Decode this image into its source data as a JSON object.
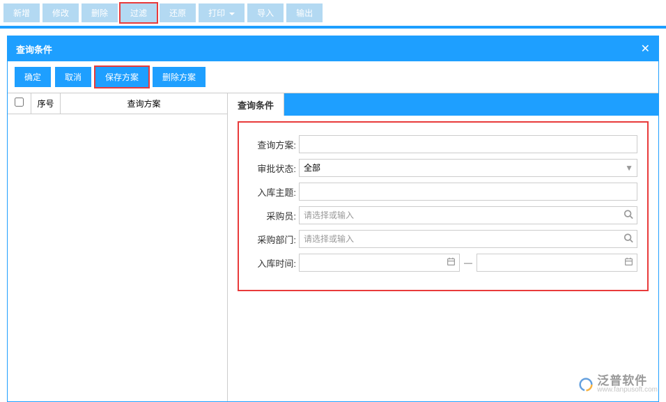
{
  "toolbar": {
    "new": "新增",
    "modify": "修改",
    "delete": "删除",
    "filter": "过滤",
    "restore": "还原",
    "print": "打印",
    "import": "导入",
    "export": "输出"
  },
  "panel": {
    "title": "查询条件"
  },
  "actions": {
    "confirm": "确定",
    "cancel": "取消",
    "save_scheme": "保存方案",
    "delete_scheme": "删除方案"
  },
  "table": {
    "seq": "序号",
    "scheme": "查询方案"
  },
  "tab": {
    "conditions": "查询条件"
  },
  "form": {
    "scheme_label": "查询方案:",
    "approval_label": "审批状态:",
    "approval_value": "全部",
    "subject_label": "入库主题:",
    "buyer_label": "采购员:",
    "buyer_placeholder": "请选择或输入",
    "dept_label": "采购部门:",
    "dept_placeholder": "请选择或输入",
    "time_label": "入库时间:",
    "range_sep": "—"
  },
  "watermark": {
    "cn": "泛普软件",
    "url": "www.fanpusoft.com"
  }
}
